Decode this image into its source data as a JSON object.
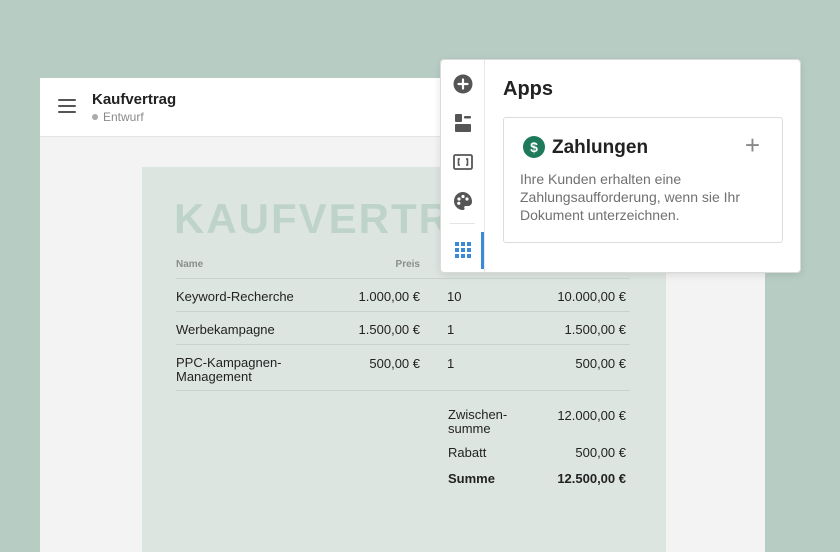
{
  "header": {
    "title": "Kaufvertrag",
    "status": "Entwurf"
  },
  "document": {
    "heading": "KAUFVERTRAG",
    "columns": {
      "name": "Name",
      "price": "Preis"
    },
    "rows": [
      {
        "name": "Keyword-Recherche",
        "price": "1.000,00 €",
        "qty": "10",
        "total": "10.000,00 €"
      },
      {
        "name": "Werbekampagne",
        "price": "1.500,00 €",
        "qty": "1",
        "total": "1.500,00 €"
      },
      {
        "name": "PPC-Kampagnen-Management",
        "price": "500,00 €",
        "qty": "1",
        "total": "500,00 €"
      }
    ],
    "totals": {
      "subtotal_label": "Zwischen-summe",
      "subtotal": "12.000,00 €",
      "discount_label": "Rabatt",
      "discount": "500,00 €",
      "sum_label": "Summe",
      "sum": "12.500,00 €"
    }
  },
  "panel": {
    "title": "Apps",
    "rail": [
      "plus-circle-icon",
      "content-blocks-icon",
      "frame-icon",
      "palette-icon",
      "apps-grid-icon"
    ],
    "app": {
      "icon": "dollar-icon",
      "name": "Zahlungen",
      "add_symbol": "+",
      "description": "Ihre Kunden erhalten eine Zahlungsaufforderung, wenn sie Ihr Dokument unterzeichnen."
    }
  },
  "colors": {
    "background": "#b7cdc4",
    "accent": "#3b8ad8",
    "app_icon": "#1f7a5c"
  }
}
